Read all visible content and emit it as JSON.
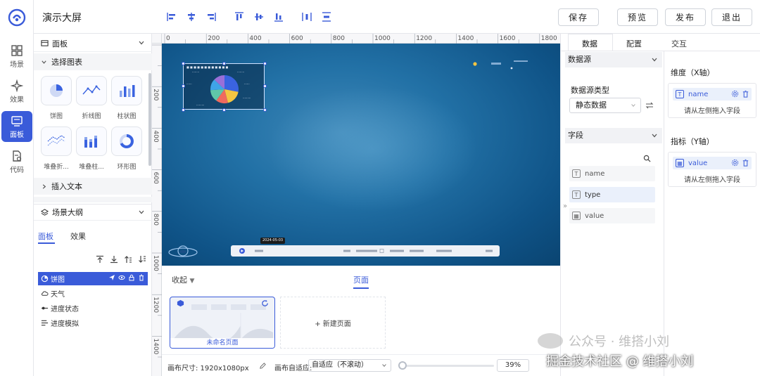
{
  "app": {
    "title": "演示大屏"
  },
  "nav": [
    {
      "key": "scene",
      "label": "场景"
    },
    {
      "key": "effect",
      "label": "效果"
    },
    {
      "key": "panel",
      "label": "面板"
    },
    {
      "key": "code",
      "label": "代码"
    }
  ],
  "toolbar": {
    "save": "保存",
    "preview": "预览",
    "publish": "发布",
    "exit": "退出"
  },
  "left_panel": {
    "panel_header": "面板",
    "select_chart": "选择图表",
    "charts": [
      "饼图",
      "折线图",
      "柱状图",
      "堆叠折...",
      "堆叠柱...",
      "环形图"
    ],
    "insert_text": "插入文本",
    "scene_outline": "场景大纲",
    "outline_tabs": [
      "面板",
      "效果"
    ],
    "layers": [
      "饼图",
      "天气",
      "进度状态",
      "进度模拟"
    ]
  },
  "canvas": {
    "ruler_top": [
      "0",
      "200",
      "400",
      "600",
      "800",
      "1000",
      "1200",
      "1400",
      "1600",
      "1800"
    ],
    "ruler_left": [
      "200",
      "400",
      "600",
      "800",
      "1000",
      "1200",
      "1400"
    ],
    "date_tip": "2024-05-03",
    "collapse": "收起",
    "pages_title": "页面",
    "page_name": "未命名页面",
    "new_page": "+ 新建页面",
    "canvas_size_label": "画布尺寸: 1920x1080px",
    "fit_label": "画布自适应:",
    "fit_value": "自适应（不滚动）",
    "zoom": "39%"
  },
  "right_panel": {
    "tabs": [
      "数据",
      "配置",
      "交互"
    ],
    "datasource_header": "数据源",
    "datasource_type_label": "数据源类型",
    "datasource_type_value": "静态数据",
    "fields_header": "字段",
    "fields": [
      "name",
      "type",
      "value"
    ],
    "x_axis_title": "维度（X轴）",
    "x_axis_field": "name",
    "y_axis_title": "指标（Y轴）",
    "y_axis_field": "value",
    "drop_hint": "请从左侧拖入字段"
  },
  "pie": {
    "slices": [
      {
        "value": 28,
        "color": "#3a63e0"
      },
      {
        "value": 18,
        "color": "#f4c542"
      },
      {
        "value": 14,
        "color": "#f06a5e"
      },
      {
        "value": 14,
        "color": "#5fc7a8"
      },
      {
        "value": 13,
        "color": "#3fa4e8"
      },
      {
        "value": 13,
        "color": "#9a6fd8"
      }
    ]
  },
  "watermark": {
    "line1": "公众号 · 维搭小刘",
    "line2": "掘金技术社区 @ 维搭小刘"
  }
}
